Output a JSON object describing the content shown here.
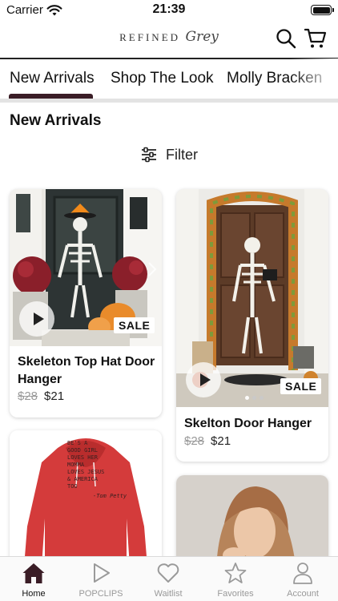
{
  "status_bar": {
    "carrier": "Carrier",
    "time": "21:39"
  },
  "brand": {
    "logo_word_a": "REFINED",
    "logo_word_b": "Grey"
  },
  "tabs": [
    {
      "label": "New Arrivals",
      "active": true
    },
    {
      "label": "Shop The Look",
      "active": false
    },
    {
      "label": "Molly Bracken",
      "active": false
    }
  ],
  "section": {
    "title": "New Arrivals",
    "filter_label": "Filter"
  },
  "products": [
    {
      "name": "Skeleton Top Hat Door Hanger",
      "original_price": "$28",
      "sale_price": "$21",
      "badge": "SALE",
      "has_video": true
    },
    {
      "name": "Skelton Door Hanger",
      "original_price": "$28",
      "sale_price": "$21",
      "badge": "SALE",
      "has_video": true
    },
    {
      "name": "",
      "shirt_print": [
        "BE'S A",
        "GOOD GIRL",
        "LOVES HER",
        "MOMMA",
        "LOVES JESUS",
        "& AMERICA",
        "TOO",
        "-Tom Petty"
      ]
    },
    {
      "name": ""
    }
  ],
  "bottom_nav": [
    {
      "label": "Home",
      "icon": "home-icon",
      "active": true
    },
    {
      "label": "POPCLIPS",
      "icon": "play-icon",
      "active": false
    },
    {
      "label": "Waitlist",
      "icon": "heart-icon",
      "active": false
    },
    {
      "label": "Favorites",
      "icon": "star-icon",
      "active": false
    },
    {
      "label": "Account",
      "icon": "person-icon",
      "active": false
    }
  ],
  "colors": {
    "accent": "#3a1d26",
    "inactive_nav": "#999999",
    "sale_badge_bg": "#ffffff"
  }
}
